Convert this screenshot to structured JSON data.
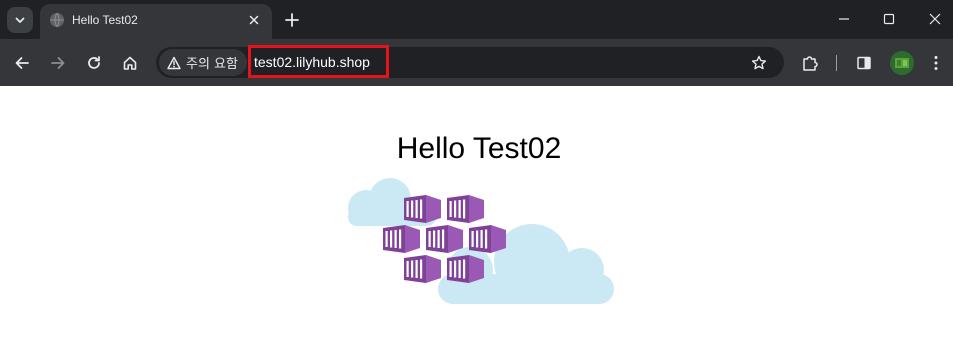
{
  "browser": {
    "tab": {
      "title": "Hello Test02"
    },
    "omnibox": {
      "security_label": "주의 요함",
      "url": "test02.lilyhub.shop"
    },
    "icons": {
      "tab_search": "chevron-down-icon",
      "favicon": "globe-icon",
      "tab_close": "close-icon",
      "new_tab": "plus-icon",
      "minimize": "minimize-icon",
      "maximize": "maximize-icon",
      "close_window": "close-icon",
      "back": "arrow-left-icon",
      "forward": "arrow-right-icon",
      "reload": "reload-icon",
      "home": "home-icon",
      "warning": "warning-triangle-icon",
      "bookmark": "star-icon",
      "extensions": "puzzle-icon",
      "side_panel": "side-panel-icon",
      "menu": "kebab-menu-icon"
    },
    "colors": {
      "highlight_box": "#e5141c"
    }
  },
  "page": {
    "heading": "Hello Test02",
    "logo": {
      "name": "azure-container-apps-logo",
      "colors": {
        "cloud": "#cbe9f4",
        "cube": "#7f4297",
        "cube_light": "#9b59b6"
      }
    }
  }
}
